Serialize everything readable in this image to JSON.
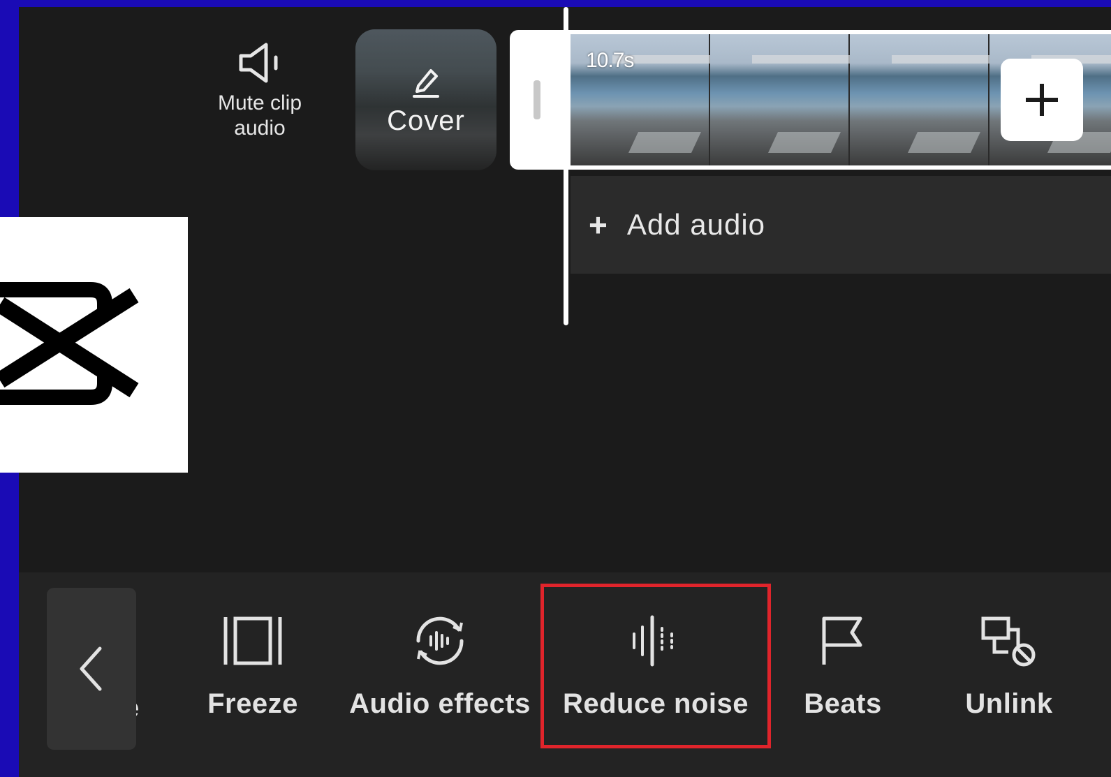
{
  "timeline": {
    "mute_label": "Mute clip audio",
    "cover_label": "Cover",
    "clip_duration": "10.7s",
    "add_audio_label": "Add audio"
  },
  "toolbar": {
    "partial_label": "e",
    "items": [
      {
        "label": "Freeze",
        "icon": "freeze-icon"
      },
      {
        "label": "Audio effects",
        "icon": "audio-effects-icon"
      },
      {
        "label": "Reduce noise",
        "icon": "reduce-noise-icon",
        "highlighted": true
      },
      {
        "label": "Beats",
        "icon": "flag-icon"
      },
      {
        "label": "Unlink",
        "icon": "unlink-icon"
      }
    ]
  },
  "colors": {
    "frame_border": "#1a0bb5",
    "background": "#1b1b1b",
    "toolbar": "#232323",
    "highlight": "#e0242b"
  }
}
